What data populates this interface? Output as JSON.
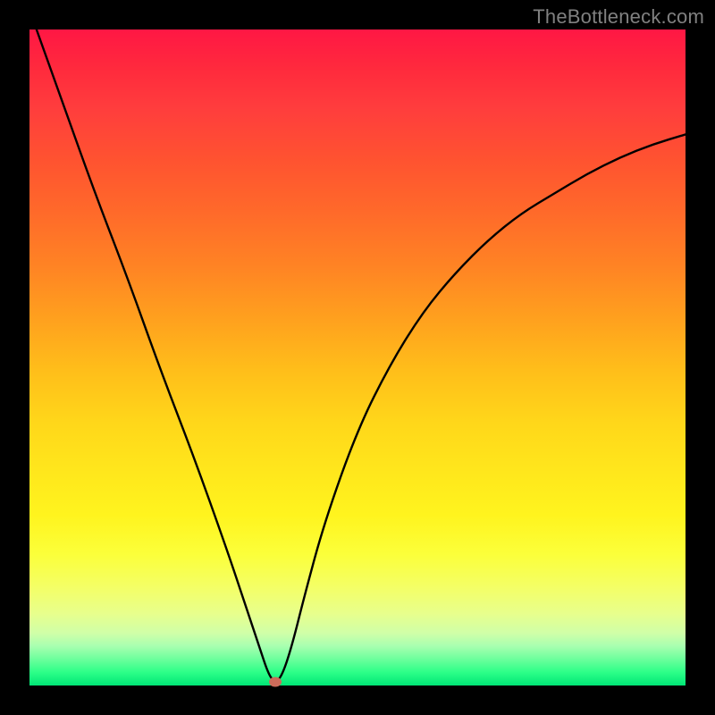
{
  "watermark": "TheBottleneck.com",
  "colors": {
    "frame": "#000000",
    "watermark": "#808080",
    "curve": "#000000",
    "marker": "#cc6b5a"
  },
  "chart_data": {
    "type": "line",
    "title": "",
    "xlabel": "",
    "ylabel": "",
    "xlim": [
      0,
      100
    ],
    "ylim": [
      0,
      100
    ],
    "series": [
      {
        "name": "bottleneck-curve",
        "x": [
          0,
          5,
          10,
          15,
          20,
          25,
          30,
          33,
          35,
          36.5,
          37.5,
          38.5,
          40,
          42,
          45,
          50,
          55,
          60,
          65,
          70,
          75,
          80,
          85,
          90,
          95,
          100
        ],
        "values": [
          103,
          89,
          75,
          62,
          48,
          35,
          21,
          12,
          6,
          1.5,
          0.5,
          1.5,
          6,
          14,
          25,
          39,
          49,
          57,
          63,
          68,
          72,
          75,
          78,
          80.5,
          82.5,
          84
        ]
      }
    ],
    "marker": {
      "x": 37.5,
      "y": 0.5
    },
    "gradient_stops": [
      {
        "pct": 0,
        "color": "#ff1744"
      },
      {
        "pct": 50,
        "color": "#ffc107"
      },
      {
        "pct": 85,
        "color": "#fff176"
      },
      {
        "pct": 100,
        "color": "#00e676"
      }
    ]
  }
}
